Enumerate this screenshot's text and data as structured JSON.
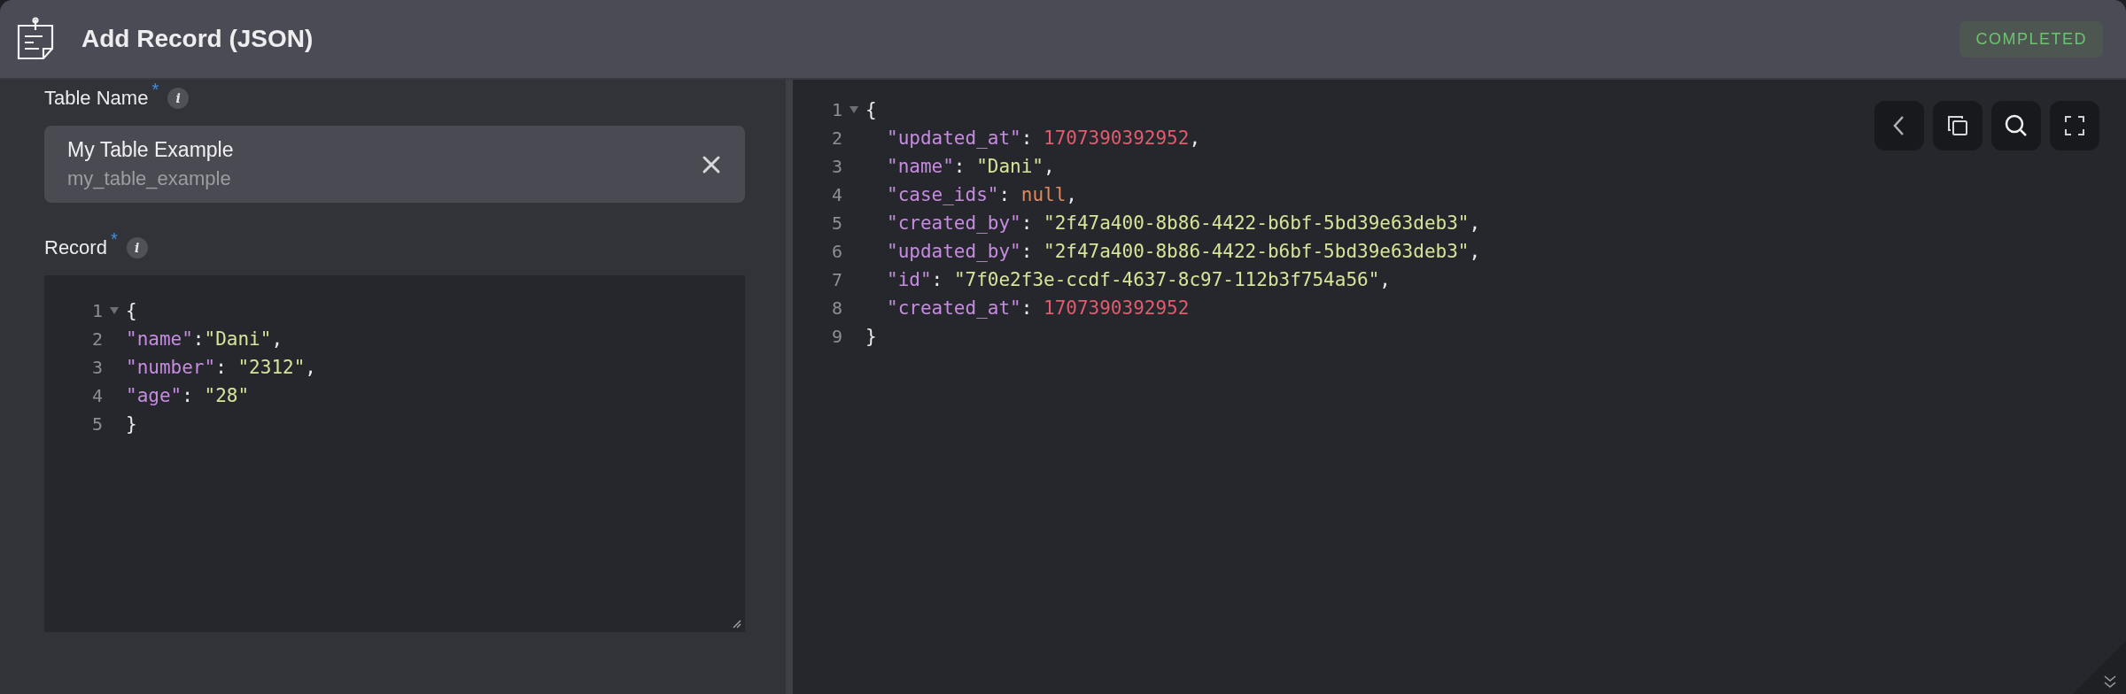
{
  "header": {
    "title": "Add Record (JSON)",
    "status": "COMPLETED"
  },
  "form": {
    "table_name": {
      "label": "Table Name",
      "required_mark": "*",
      "info": "i",
      "value": "My Table Example",
      "subvalue": "my_table_example"
    },
    "record": {
      "label": "Record",
      "required_mark": "*",
      "info": "i",
      "lines": [
        {
          "number": "1",
          "foldable": true,
          "indented": false,
          "tokens": [
            {
              "kind": "punct",
              "text": "{"
            }
          ]
        },
        {
          "number": "2",
          "foldable": false,
          "indented": false,
          "tokens": [
            {
              "kind": "key",
              "text": "\"name\""
            },
            {
              "kind": "punct",
              "text": ":"
            },
            {
              "kind": "string",
              "text": "\"Dani\""
            },
            {
              "kind": "punct",
              "text": ","
            }
          ]
        },
        {
          "number": "3",
          "foldable": false,
          "indented": false,
          "tokens": [
            {
              "kind": "key",
              "text": "\"number\""
            },
            {
              "kind": "punct",
              "text": ": "
            },
            {
              "kind": "string",
              "text": "\"2312\""
            },
            {
              "kind": "punct",
              "text": ","
            }
          ]
        },
        {
          "number": "4",
          "foldable": false,
          "indented": false,
          "tokens": [
            {
              "kind": "key",
              "text": "\"age\""
            },
            {
              "kind": "punct",
              "text": ": "
            },
            {
              "kind": "string",
              "text": "\"28\""
            }
          ]
        },
        {
          "number": "5",
          "foldable": false,
          "indented": false,
          "tokens": [
            {
              "kind": "punct",
              "text": "}"
            }
          ]
        }
      ]
    }
  },
  "result": {
    "lines": [
      {
        "number": "1",
        "foldable": true,
        "indented": false,
        "tokens": [
          {
            "kind": "punct",
            "text": "{"
          }
        ]
      },
      {
        "number": "2",
        "foldable": false,
        "indented": true,
        "tokens": [
          {
            "kind": "key",
            "text": "\"updated_at\""
          },
          {
            "kind": "punct",
            "text": ": "
          },
          {
            "kind": "number",
            "text": "1707390392952"
          },
          {
            "kind": "punct",
            "text": ","
          }
        ]
      },
      {
        "number": "3",
        "foldable": false,
        "indented": true,
        "tokens": [
          {
            "kind": "key",
            "text": "\"name\""
          },
          {
            "kind": "punct",
            "text": ": "
          },
          {
            "kind": "string",
            "text": "\"Dani\""
          },
          {
            "kind": "punct",
            "text": ","
          }
        ]
      },
      {
        "number": "4",
        "foldable": false,
        "indented": true,
        "tokens": [
          {
            "kind": "key",
            "text": "\"case_ids\""
          },
          {
            "kind": "punct",
            "text": ": "
          },
          {
            "kind": "null",
            "text": "null"
          },
          {
            "kind": "punct",
            "text": ","
          }
        ]
      },
      {
        "number": "5",
        "foldable": false,
        "indented": true,
        "tokens": [
          {
            "kind": "key",
            "text": "\"created_by\""
          },
          {
            "kind": "punct",
            "text": ": "
          },
          {
            "kind": "string",
            "text": "\"2f47a400-8b86-4422-b6bf-5bd39e63deb3\""
          },
          {
            "kind": "punct",
            "text": ","
          }
        ]
      },
      {
        "number": "6",
        "foldable": false,
        "indented": true,
        "tokens": [
          {
            "kind": "key",
            "text": "\"updated_by\""
          },
          {
            "kind": "punct",
            "text": ": "
          },
          {
            "kind": "string",
            "text": "\"2f47a400-8b86-4422-b6bf-5bd39e63deb3\""
          },
          {
            "kind": "punct",
            "text": ","
          }
        ]
      },
      {
        "number": "7",
        "foldable": false,
        "indented": true,
        "tokens": [
          {
            "kind": "key",
            "text": "\"id\""
          },
          {
            "kind": "punct",
            "text": ": "
          },
          {
            "kind": "string",
            "text": "\"7f0e2f3e-ccdf-4637-8c97-112b3f754a56\""
          },
          {
            "kind": "punct",
            "text": ","
          }
        ]
      },
      {
        "number": "8",
        "foldable": false,
        "indented": true,
        "tokens": [
          {
            "kind": "key",
            "text": "\"created_at\""
          },
          {
            "kind": "punct",
            "text": ": "
          },
          {
            "kind": "number",
            "text": "1707390392952"
          }
        ]
      },
      {
        "number": "9",
        "foldable": false,
        "indented": false,
        "tokens": [
          {
            "kind": "punct",
            "text": "}"
          }
        ]
      }
    ]
  }
}
